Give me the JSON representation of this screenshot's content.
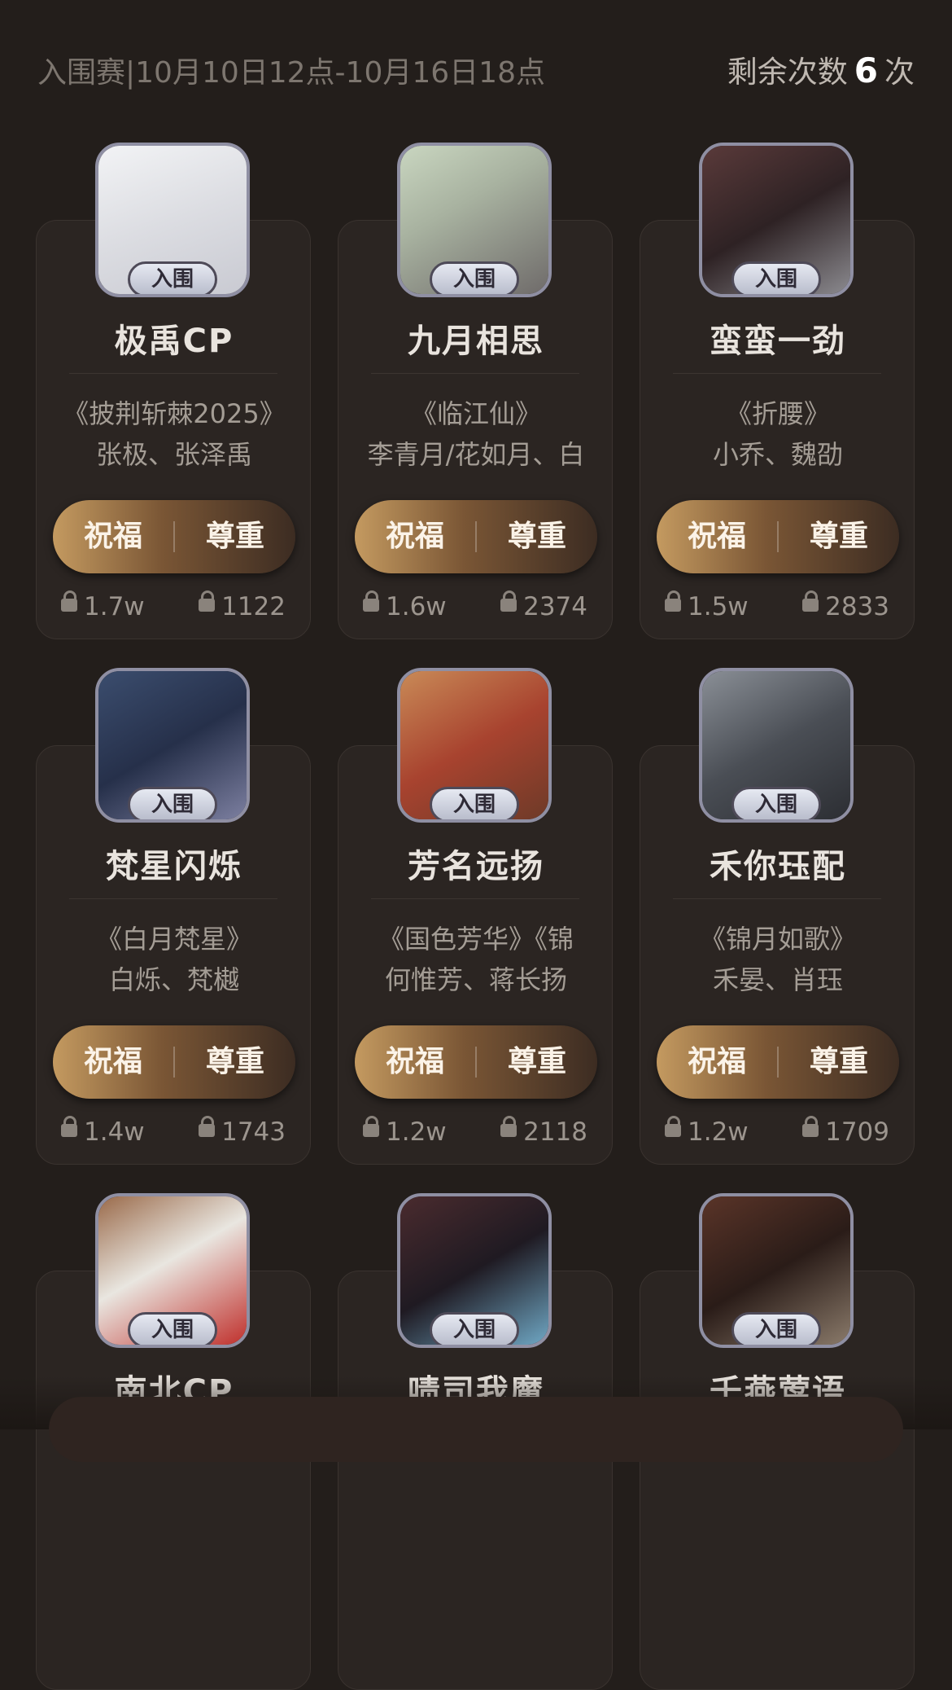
{
  "header": {
    "round_info": "入围赛|10月10日12点-10月16日18点",
    "remaining_label": "剩余次数",
    "remaining_count": "6",
    "remaining_unit": "次"
  },
  "cards": [
    {
      "badge": "入围",
      "name": "极禹CP",
      "work": "《披荆斩棘2025》",
      "people": "张极、张泽禹",
      "bless_label": "祝福",
      "respect_label": "尊重",
      "bless_count": "1.7w",
      "respect_count": "1122"
    },
    {
      "badge": "入围",
      "name": "九月相思",
      "work": "《临江仙》",
      "people": "李青月/花如月、白",
      "bless_label": "祝福",
      "respect_label": "尊重",
      "bless_count": "1.6w",
      "respect_count": "2374"
    },
    {
      "badge": "入围",
      "name": "蛮蛮一劲",
      "work": "《折腰》",
      "people": "小乔、魏劭",
      "bless_label": "祝福",
      "respect_label": "尊重",
      "bless_count": "1.5w",
      "respect_count": "2833"
    },
    {
      "badge": "入围",
      "name": "梵星闪烁",
      "work": "《白月梵星》",
      "people": "白烁、梵樾",
      "bless_label": "祝福",
      "respect_label": "尊重",
      "bless_count": "1.4w",
      "respect_count": "1743"
    },
    {
      "badge": "入围",
      "name": "芳名远扬",
      "work": "《国色芳华》《锦",
      "people": "何惟芳、蒋长扬",
      "bless_label": "祝福",
      "respect_label": "尊重",
      "bless_count": "1.2w",
      "respect_count": "2118"
    },
    {
      "badge": "入围",
      "name": "禾你珏配",
      "work": "《锦月如歌》",
      "people": "禾晏、肖珏",
      "bless_label": "祝福",
      "respect_label": "尊重",
      "bless_count": "1.2w",
      "respect_count": "1709"
    },
    {
      "badge": "入围",
      "name": "南北CP"
    },
    {
      "badge": "入围",
      "name": "啧司我魔"
    },
    {
      "badge": "入围",
      "name": "千燕莺语"
    }
  ],
  "colors": {
    "background": "#231e1b",
    "card": "#2b2522",
    "button_gradient_start": "#c49a60",
    "button_gradient_end": "#3c2c22"
  },
  "icons": {
    "stat_icon": "lock-icon"
  }
}
